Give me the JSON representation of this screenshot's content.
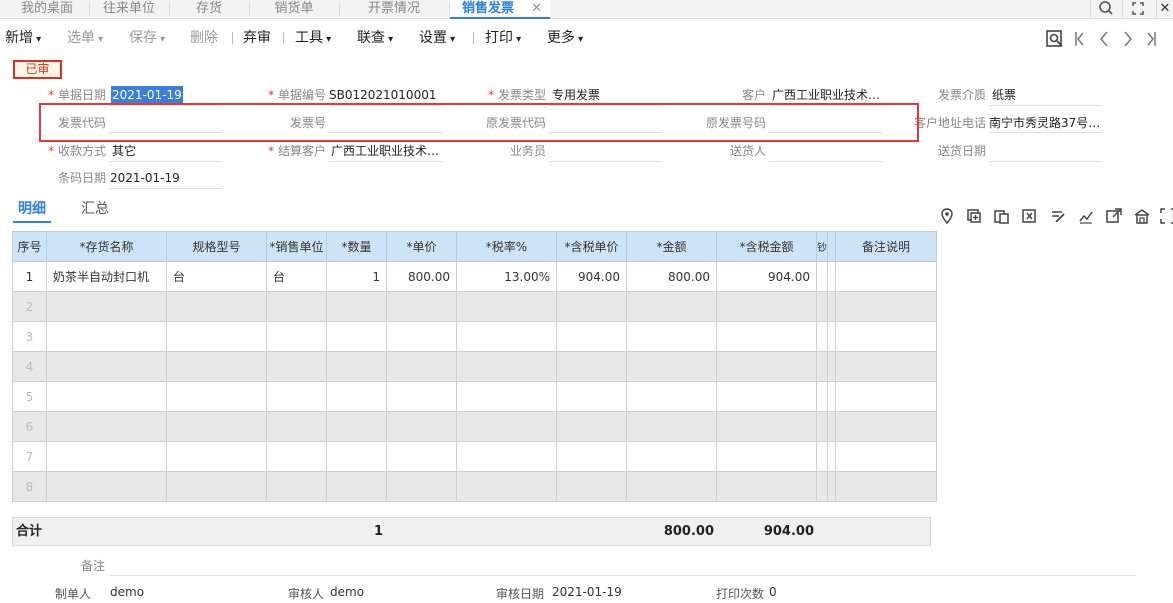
{
  "tabs": [
    "我的桌面",
    "往来单位",
    "存货",
    "销货单",
    "开票情况",
    "销售发票"
  ],
  "top_icons": [
    "search-icon",
    "fullscreen-icon",
    "close-icon"
  ],
  "toolbar": {
    "new": "新增",
    "select": "选单",
    "save": "保存",
    "delete": "删除",
    "abandon": "弃审",
    "tools": "工具",
    "lookup": "联查",
    "settings": "设置",
    "print": "打印",
    "more": "更多"
  },
  "nav_icons": [
    "preview-icon",
    "first-icon",
    "prev-icon",
    "next-icon",
    "last-icon"
  ],
  "status": "已审",
  "form": {
    "doc_date_label": "单据日期",
    "doc_date": "2021-01-19",
    "doc_no_label": "单据编号",
    "doc_no": "SB012021010001",
    "invoice_type_label": "发票类型",
    "invoice_type": "专用发票",
    "customer_label": "客户",
    "customer": "广西工业职业技术…",
    "medium_label": "发票介质",
    "medium": "纸票",
    "invoice_code_label": "发票代码",
    "invoice_no_label": "发票号",
    "orig_code_label": "原发票代码",
    "orig_no_label": "原发票号码",
    "addr_label": "客户地址电话",
    "addr": "南宁市秀灵路37号…",
    "payment_label": "收款方式",
    "payment": "其它",
    "settle_label": "结算客户",
    "settle": "广西工业职业技术…",
    "salesman_label": "业务员",
    "deliverer_label": "送货人",
    "delivery_date_label": "送货日期",
    "barcode_date_label": "条码日期",
    "barcode_date": "2021-01-19"
  },
  "subtabs": {
    "detail": "明细",
    "summary": "汇总"
  },
  "grid": {
    "headers": [
      "序号",
      "*存货名称",
      "规格型号",
      "*销售单位",
      "*数量",
      "*单价",
      "*税率%",
      "*含税单价",
      "*金额",
      "*含税金额",
      "钞",
      "",
      "备注说明"
    ],
    "rows": [
      [
        "1",
        "奶茶半自动封口机",
        "台",
        "台",
        "1",
        "800.00",
        "13.00%",
        "904.00",
        "800.00",
        "904.00",
        "",
        "",
        ""
      ],
      [
        "2",
        "",
        "",
        "",
        "",
        "",
        "",
        "",
        "",
        "",
        "",
        "",
        ""
      ],
      [
        "3",
        "",
        "",
        "",
        "",
        "",
        "",
        "",
        "",
        "",
        "",
        "",
        ""
      ],
      [
        "4",
        "",
        "",
        "",
        "",
        "",
        "",
        "",
        "",
        "",
        "",
        "",
        ""
      ],
      [
        "5",
        "",
        "",
        "",
        "",
        "",
        "",
        "",
        "",
        "",
        "",
        "",
        ""
      ],
      [
        "6",
        "",
        "",
        "",
        "",
        "",
        "",
        "",
        "",
        "",
        "",
        "",
        ""
      ],
      [
        "7",
        "",
        "",
        "",
        "",
        "",
        "",
        "",
        "",
        "",
        "",
        "",
        ""
      ],
      [
        "8",
        "",
        "",
        "",
        "",
        "",
        "",
        "",
        "",
        "",
        "",
        "",
        ""
      ]
    ]
  },
  "total": {
    "label": "合计",
    "qty": "1",
    "amount": "800.00",
    "tax_amount": "904.00"
  },
  "footer": {
    "remark_label": "备注",
    "maker_label": "制单人",
    "maker": "demo",
    "auditor_label": "审核人",
    "auditor": "demo",
    "audit_date_label": "审核日期",
    "audit_date": "2021-01-19",
    "print_count_label": "打印次数",
    "print_count": "0"
  },
  "colors": {
    "accent": "#2f7fe0",
    "highlight_box": "#e53935",
    "header_bg": "#cfe3f7",
    "status": "#d93025"
  }
}
